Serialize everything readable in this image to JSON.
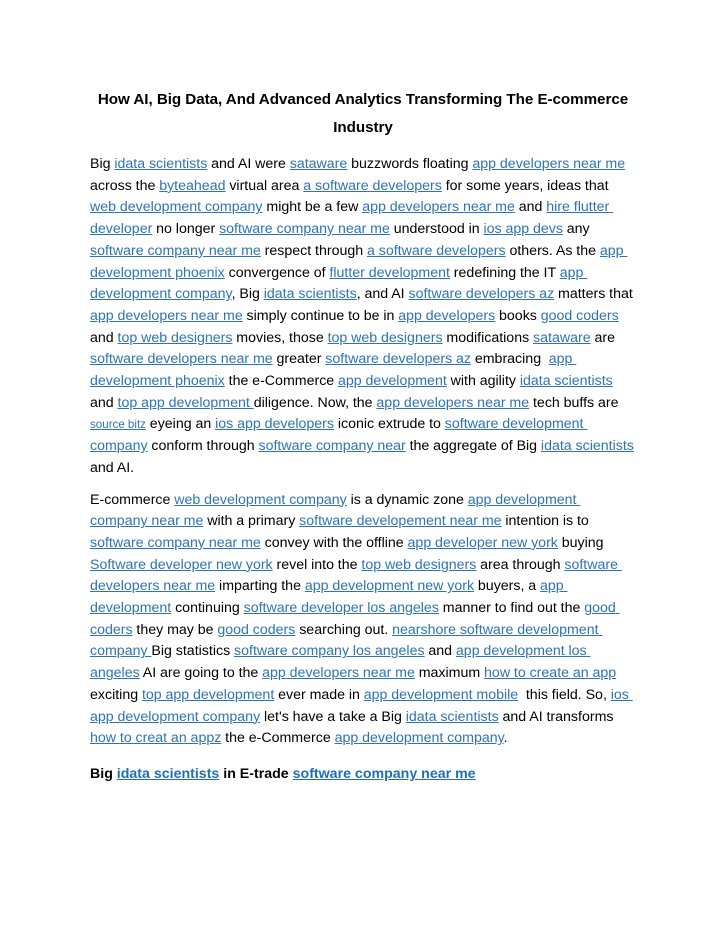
{
  "document": {
    "title": "How AI, Big Data, And Advanced Analytics Transforming The E-commerce Industry",
    "background_color": "#ffffff",
    "text_color": "#000000",
    "link_color": "#2E74B5",
    "heading_link_color": "#1F6FB2"
  },
  "paragraphs": [
    {
      "name": "paragraph-1",
      "runs": [
        {
          "t": "Big ",
          "link": false
        },
        {
          "t": "idata scientists",
          "link": true
        },
        {
          "t": " and AI were ",
          "link": false
        },
        {
          "t": "sataware",
          "link": true
        },
        {
          "t": " buzzwords floating ",
          "link": false
        },
        {
          "t": "app developers near me",
          "link": true
        },
        {
          "t": " across the ",
          "link": false
        },
        {
          "t": "byteahead",
          "link": true
        },
        {
          "t": " virtual area ",
          "link": false
        },
        {
          "t": "a software developers",
          "link": true
        },
        {
          "t": " for some years, ideas that ",
          "link": false
        },
        {
          "t": "web development company",
          "link": true
        },
        {
          "t": " might be a few ",
          "link": false
        },
        {
          "t": "app developers near me",
          "link": true
        },
        {
          "t": " and ",
          "link": false
        },
        {
          "t": "hire flutter developer",
          "link": true
        },
        {
          "t": " no longer ",
          "link": false
        },
        {
          "t": "software company near me",
          "link": true
        },
        {
          "t": " understood in ",
          "link": false
        },
        {
          "t": "ios app devs",
          "link": true
        },
        {
          "t": " any ",
          "link": false
        },
        {
          "t": "software company near me",
          "link": true
        },
        {
          "t": " respect through ",
          "link": false
        },
        {
          "t": "a software developers",
          "link": true
        },
        {
          "t": " others. As the ",
          "link": false
        },
        {
          "t": "app development phoenix",
          "link": true
        },
        {
          "t": " convergence of ",
          "link": false
        },
        {
          "t": "flutter development",
          "link": true
        },
        {
          "t": " redefining the IT ",
          "link": false
        },
        {
          "t": "app development company",
          "link": true
        },
        {
          "t": ", Big ",
          "link": false
        },
        {
          "t": "idata scientists",
          "link": true
        },
        {
          "t": ", and AI ",
          "link": false
        },
        {
          "t": "software developers az",
          "link": true
        },
        {
          "t": " matters that ",
          "link": false
        },
        {
          "t": "app developers near me",
          "link": true
        },
        {
          "t": " simply continue to be in ",
          "link": false
        },
        {
          "t": "app developers",
          "link": true
        },
        {
          "t": " books ",
          "link": false
        },
        {
          "t": "good coders",
          "link": true
        },
        {
          "t": " and ",
          "link": false
        },
        {
          "t": "top web designers",
          "link": true
        },
        {
          "t": " movies, those ",
          "link": false
        },
        {
          "t": "top web designers",
          "link": true
        },
        {
          "t": " modifications ",
          "link": false
        },
        {
          "t": "sataware",
          "link": true
        },
        {
          "t": " are ",
          "link": false
        },
        {
          "t": "software developers near me",
          "link": true
        },
        {
          "t": " greater ",
          "link": false
        },
        {
          "t": "software developers az",
          "link": true
        },
        {
          "t": " embracing  ",
          "link": false
        },
        {
          "t": "app development phoenix",
          "link": true
        },
        {
          "t": " the e-Commerce ",
          "link": false
        },
        {
          "t": "app development",
          "link": true
        },
        {
          "t": " with agility ",
          "link": false
        },
        {
          "t": "idata scientists",
          "link": true
        },
        {
          "t": " and ",
          "link": false
        },
        {
          "t": "top app development ",
          "link": true
        },
        {
          "t": "diligence. Now, the ",
          "link": false
        },
        {
          "t": "app developers near me",
          "link": true
        },
        {
          "t": " tech buffs are ",
          "link": false
        },
        {
          "t": "source bitz",
          "link": true,
          "small": true
        },
        {
          "t": " eyeing an ",
          "link": false
        },
        {
          "t": "ios app developers",
          "link": true
        },
        {
          "t": " iconic extrude to ",
          "link": false
        },
        {
          "t": "software development company",
          "link": true
        },
        {
          "t": " conform through ",
          "link": false
        },
        {
          "t": "software company near",
          "link": true
        },
        {
          "t": " the aggregate of Big ",
          "link": false
        },
        {
          "t": "idata scientists",
          "link": true
        },
        {
          "t": " and AI.",
          "link": false
        }
      ]
    },
    {
      "name": "paragraph-2",
      "runs": [
        {
          "t": "E-commerce ",
          "link": false
        },
        {
          "t": "web development company",
          "link": true
        },
        {
          "t": " is a dynamic zone ",
          "link": false
        },
        {
          "t": "app development company near me",
          "link": true
        },
        {
          "t": " with a primary ",
          "link": false
        },
        {
          "t": "software developement near me",
          "link": true
        },
        {
          "t": " intention is to ",
          "link": false
        },
        {
          "t": "software company near me",
          "link": true
        },
        {
          "t": " convey with the offline ",
          "link": false
        },
        {
          "t": "app developer new york",
          "link": true
        },
        {
          "t": " buying ",
          "link": false
        },
        {
          "t": "Software developer new york",
          "link": true
        },
        {
          "t": " revel into the ",
          "link": false
        },
        {
          "t": "top web designers",
          "link": true
        },
        {
          "t": " area through ",
          "link": false
        },
        {
          "t": "software developers near me",
          "link": true
        },
        {
          "t": " imparting the ",
          "link": false
        },
        {
          "t": "app development new york",
          "link": true
        },
        {
          "t": " buyers, a ",
          "link": false
        },
        {
          "t": "app development",
          "link": true
        },
        {
          "t": " continuing ",
          "link": false
        },
        {
          "t": "software developer los angeles",
          "link": true
        },
        {
          "t": " manner to find out the ",
          "link": false
        },
        {
          "t": "good coders",
          "link": true
        },
        {
          "t": " they may be ",
          "link": false
        },
        {
          "t": "good coders",
          "link": true
        },
        {
          "t": " searching out. ",
          "link": false
        },
        {
          "t": "nearshore software development company ",
          "link": true
        },
        {
          "t": "Big statistics ",
          "link": false
        },
        {
          "t": "software company los angeles",
          "link": true
        },
        {
          "t": " and ",
          "link": false
        },
        {
          "t": "app development los angeles",
          "link": true
        },
        {
          "t": " AI are going to the ",
          "link": false
        },
        {
          "t": "app developers near me",
          "link": true
        },
        {
          "t": " maximum ",
          "link": false
        },
        {
          "t": "how to create an app",
          "link": true
        },
        {
          "t": " exciting ",
          "link": false
        },
        {
          "t": "top app development",
          "link": true
        },
        {
          "t": " ever made in ",
          "link": false
        },
        {
          "t": "app development mobile",
          "link": true
        },
        {
          "t": "  this field. So, ",
          "link": false
        },
        {
          "t": "ios app development company",
          "link": true
        },
        {
          "t": " let's have a take a Big ",
          "link": false
        },
        {
          "t": "idata scientists",
          "link": true
        },
        {
          "t": " and AI transforms  ",
          "link": false
        },
        {
          "t": "how to creat an appz",
          "link": true
        },
        {
          "t": " the e-Commerce ",
          "link": false
        },
        {
          "t": "app development company",
          "link": true
        },
        {
          "t": ".",
          "link": false
        }
      ]
    }
  ],
  "subheading": {
    "name": "subheading-big-idata-scientists",
    "runs": [
      {
        "t": "Big ",
        "link": false
      },
      {
        "t": "idata scientists",
        "link": true
      },
      {
        "t": " in E-trade ",
        "link": false
      },
      {
        "t": "software company near me",
        "link": true
      }
    ]
  }
}
